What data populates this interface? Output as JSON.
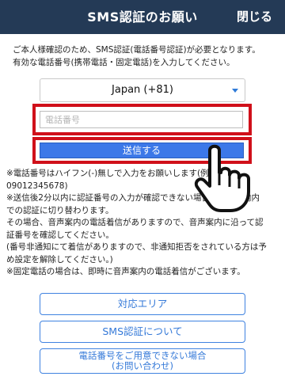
{
  "header": {
    "title": "SMS認証のお願い",
    "close_label": "閉じる"
  },
  "intro": {
    "line1": "ご本人様確認のため、SMS認証(電話番号認証)が必要となります。",
    "line2": "有効な電話番号(携帯電話・固定電話)を入力してください。"
  },
  "form": {
    "country_value": "Japan (+81)",
    "phone_placeholder": "電話番号",
    "phone_value": "",
    "send_label": "送信する"
  },
  "notes": [
    "※電話番号はハイフン(-)無しで入力をお願いします(例",
    "09012345678)",
    "※送信後2分以内に認証番号の入力が確認できない場合、音声案内内",
    "での認証に切り替わります。",
    "その場合、音声案内の電話着信がありますので、音声案内に沿って認",
    "証番号を確認してください。",
    "(番号非通知にて着信がありますので、非通知拒否をされている方は予",
    "め設定を解除してください。)",
    "※固定電話の場合は、即時に音声案内の電話着信がございます。"
  ],
  "links": {
    "area_label": "対応エリア",
    "about_sms_label": "SMS認証について",
    "no_phone_line1": "電話番号をご用意できない場合",
    "no_phone_line2": "(お問い合わせ)"
  },
  "colors": {
    "header_bg": "#243a56",
    "send_button": "#3c78e8",
    "highlight": "#d0101a",
    "link": "#3479d8"
  },
  "icons": {
    "pointer": "pointing-hand-icon",
    "dropdown": "caret-down-icon"
  }
}
